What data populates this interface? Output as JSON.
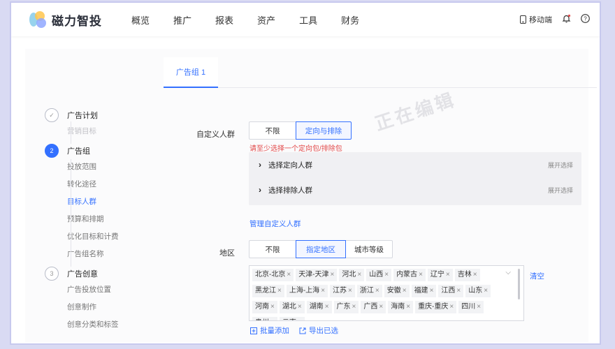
{
  "brand": {
    "name": "磁力智投"
  },
  "nav": {
    "items": [
      "概览",
      "推广",
      "报表",
      "资产",
      "工具",
      "财务"
    ],
    "mobile_label": "移动端"
  },
  "tabs": {
    "active": "广告组 1"
  },
  "watermark": "正在编辑",
  "steps": [
    {
      "num": "✓",
      "title": "广告计划",
      "subs": [
        {
          "label": "营销目标",
          "state": "muted"
        }
      ]
    },
    {
      "num": "2",
      "title": "广告组",
      "subs": [
        {
          "label": "投放范围",
          "state": ""
        },
        {
          "label": "转化途径",
          "state": ""
        },
        {
          "label": "目标人群",
          "state": "active"
        },
        {
          "label": "预算和排期",
          "state": ""
        },
        {
          "label": "优化目标和计费",
          "state": ""
        },
        {
          "label": "广告组名称",
          "state": ""
        }
      ]
    },
    {
      "num": "3",
      "title": "广告创意",
      "subs": [
        {
          "label": "广告投放位置",
          "state": ""
        },
        {
          "label": "创意制作",
          "state": ""
        },
        {
          "label": "创意分类和标签",
          "state": ""
        }
      ]
    }
  ],
  "custom_crowd": {
    "label": "自定义人群",
    "options": [
      "不限",
      "定向与排除"
    ],
    "selected": 1,
    "error": "请至少选择一个定向包/排除包",
    "rows": [
      {
        "label": "选择定向人群",
        "action": "展开选择"
      },
      {
        "label": "选择排除人群",
        "action": "展开选择"
      }
    ],
    "manage_link": "管理自定义人群"
  },
  "region": {
    "label": "地区",
    "options": [
      "不限",
      "指定地区",
      "城市等级"
    ],
    "selected": 1,
    "tags": [
      "北京-北京",
      "天津-天津",
      "河北",
      "山西",
      "内蒙古",
      "辽宁",
      "吉林",
      "黑龙江",
      "上海-上海",
      "江苏",
      "浙江",
      "安徽",
      "福建",
      "江西",
      "山东",
      "河南",
      "湖北",
      "湖南",
      "广东",
      "广西",
      "海南",
      "重庆-重庆",
      "四川",
      "贵州",
      "云南"
    ],
    "clear": "清空",
    "bulk_add": "批量添加",
    "export": "导出已选"
  },
  "colors": {
    "accent": "#3370ff",
    "error": "#e24a4a"
  }
}
